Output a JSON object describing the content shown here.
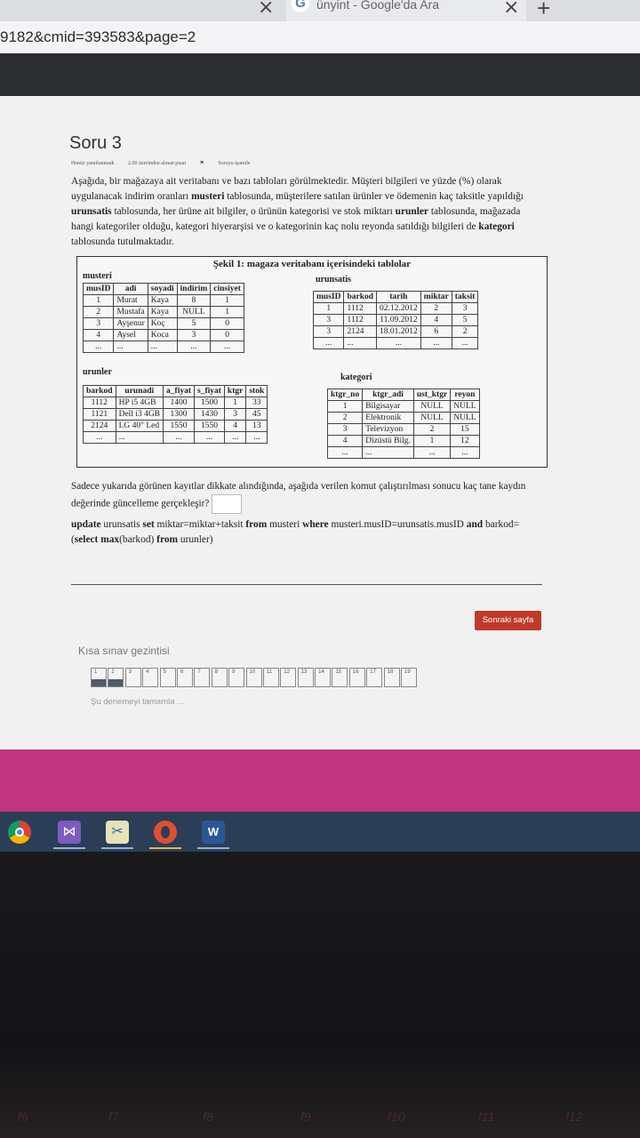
{
  "browser": {
    "tab_title": "ünyint - Google'da Ara",
    "url": "9182&cmid=393583&page=2"
  },
  "question": {
    "title": "Soru 3",
    "status": "Henüz yanıtlanmadı",
    "points": "2.00 üzerinden alınan puan",
    "flag": "Soruyu işaretle",
    "description_parts": [
      "Aşağıda, bir mağazaya ait veritabanı ve bazı tabloları görülmektedir. Müşteri bilgileri ve yüzde (%) olarak uygulanacak indirim oranları ",
      "musteri",
      " tablosunda, müşterilere satılan ürünler ve ödemenin kaç taksitle yapıldığı ",
      "urunsatis",
      " tablosunda, her ürüne ait bilgiler, o ürünün kategorisi ve stok miktarı ",
      "urunler",
      " tablosunda, mağazada hangi kategoriler olduğu, kategori hiyerarşisi ve o kategorinin kaç nolu reyonda satıldığı bilgileri de ",
      "kategori",
      " tablosunda tutulmaktadır."
    ],
    "figure_caption": "Şekil 1: magaza veritabanı içerisindeki tablolar",
    "question_text": "Sadece yukarıda görünen kayıtlar dikkate alındığında, aşağıda verilen komut çalıştırılması sonucu kaç tane kaydın değerinde  güncelleme gerçekleşir?",
    "sql": {
      "kw_update": "update",
      "part1": " urunsatis ",
      "kw_set": "set",
      "part2": " miktar=miktar+taksit ",
      "kw_from1": "from",
      "part3": " musteri ",
      "kw_where": "where",
      "part4": " musteri.musID=urunsatis.musID ",
      "kw_and": "and",
      "part5": " barkod=(",
      "kw_select": "select max",
      "part6": "(barkod) ",
      "kw_from2": "from",
      "part7": " urunler)"
    }
  },
  "tables": {
    "musteri": {
      "name": "musteri",
      "headers": [
        "musID",
        "adi",
        "soyadi",
        "indirim",
        "cinsiyet"
      ],
      "rows": [
        [
          "1",
          "Murat",
          "Kaya",
          "8",
          "1"
        ],
        [
          "2",
          "Mustafa",
          "Kaya",
          "NULL",
          "1"
        ],
        [
          "3",
          "Ayşenur",
          "Koç",
          "5",
          "0"
        ],
        [
          "4",
          "Aysel",
          "Koca",
          "3",
          "0"
        ],
        [
          "...",
          "...",
          "...",
          "...",
          "..."
        ]
      ]
    },
    "urunsatis": {
      "name": "urunsatis",
      "headers": [
        "musID",
        "barkod",
        "tarih",
        "miktar",
        "taksit"
      ],
      "rows": [
        [
          "1",
          "1112",
          "02.12.2012",
          "2",
          "3"
        ],
        [
          "3",
          "1112",
          "11.09.2012",
          "4",
          "5"
        ],
        [
          "3",
          "2124",
          "18.01.2012",
          "6",
          "2"
        ],
        [
          "...",
          "...",
          "...",
          "...",
          "..."
        ]
      ]
    },
    "urunler": {
      "name": "urunler",
      "headers": [
        "barkod",
        "urunadi",
        "a_fiyat",
        "s_fiyat",
        "ktgr",
        "stok"
      ],
      "rows": [
        [
          "1112",
          "HP i5 4GB",
          "1400",
          "1500",
          "1",
          "33"
        ],
        [
          "1121",
          "Dell i3 4GB",
          "1300",
          "1430",
          "3",
          "45"
        ],
        [
          "2124",
          "LG 40\" Led",
          "1550",
          "1550",
          "4",
          "13"
        ],
        [
          "...",
          "...",
          "...",
          "...",
          "...",
          "..."
        ]
      ]
    },
    "kategori": {
      "name": "kategori",
      "headers": [
        "ktgr_no",
        "ktgr_adi",
        "ust_ktgr",
        "reyon"
      ],
      "rows": [
        [
          "1",
          "Bilgisayar",
          "NULL",
          "NULL"
        ],
        [
          "2",
          "Elektronik",
          "NULL",
          "NULL"
        ],
        [
          "3",
          "Televizyon",
          "2",
          "15"
        ],
        [
          "4",
          "Dizüstü Bilg.",
          "1",
          "12"
        ],
        [
          "...",
          "...",
          "...",
          "..."
        ]
      ]
    }
  },
  "navigation": {
    "next_label": "Sonraki sayfa",
    "quiz_nav_title": "Kısa sınav gezintisi",
    "pages": [
      "1",
      "2",
      "3",
      "4",
      "5",
      "6",
      "7",
      "8",
      "9",
      "10",
      "11",
      "12",
      "13",
      "14",
      "15",
      "16",
      "17",
      "18",
      "19"
    ],
    "completed_pages": 2,
    "finish_link": "Şu denemeyi tamamla ..."
  },
  "taskbar": {
    "apps": [
      "chrome-icon",
      "visual-studio-icon",
      "snipping-tool-icon",
      "opera-icon",
      "word-icon"
    ]
  },
  "keyboard": {
    "keys": [
      "f6",
      "f7",
      "f8",
      "f9",
      "f10",
      "f11",
      "f12"
    ]
  }
}
